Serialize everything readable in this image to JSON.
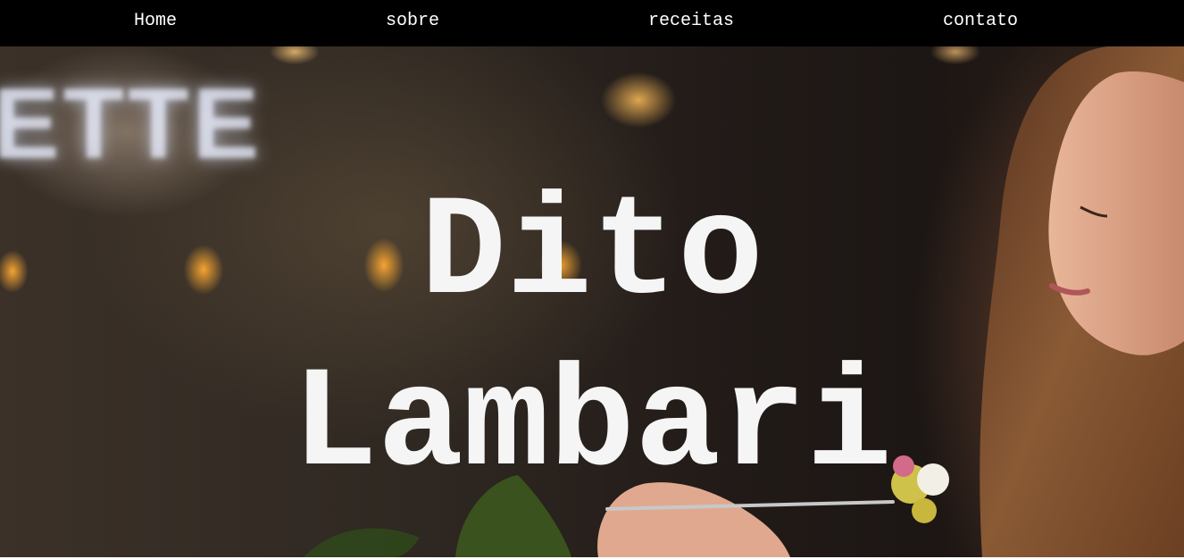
{
  "nav": {
    "items": [
      {
        "label": "Home"
      },
      {
        "label": "sobre"
      },
      {
        "label": "receitas"
      },
      {
        "label": "contato"
      }
    ]
  },
  "hero": {
    "title_line1": "Dito",
    "title_line2": "Lambari",
    "background_sign": "ETTE"
  },
  "colors": {
    "navbar_background": "#000000",
    "nav_text": "#ffffff",
    "title_text": "#f5f5f5"
  }
}
